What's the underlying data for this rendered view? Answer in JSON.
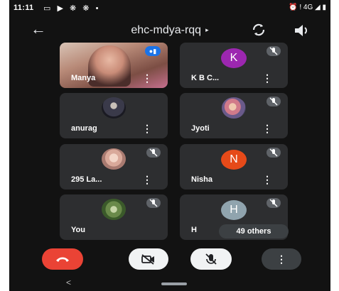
{
  "status": {
    "time": "11:11",
    "left_icons": [
      "cast-icon",
      "play-icon",
      "settings-icon",
      "settings-icon",
      "dot-icon"
    ],
    "right_text": "⏰ ! 4G ◢ ▮"
  },
  "topbar": {
    "meeting_code": "ehc-mdya-rqq",
    "code_arrow": "▸"
  },
  "tiles": [
    {
      "name": "Manya",
      "avatar": "video"
    },
    {
      "name": "K B C...",
      "avatar_letter": "K",
      "avatar_color": "#9c27b0"
    },
    {
      "name": "anurag",
      "avatar": "photo"
    },
    {
      "name": "Jyoti",
      "avatar": "photo"
    },
    {
      "name": "295 La...",
      "avatar": "photo"
    },
    {
      "name": "Nisha",
      "avatar_letter": "N",
      "avatar_color": "#e64a19"
    },
    {
      "name": "You",
      "avatar": "photo"
    },
    {
      "name": "H",
      "avatar_letter": "H",
      "avatar_color": "#90a4ae"
    }
  ],
  "others_label": "49 others",
  "menu_glyph": "⋮",
  "colors": {
    "background": "#121212",
    "tile": "#2d2e30",
    "end_call": "#ea4335",
    "speaking": "#1a73e8"
  },
  "controls": [
    "end-call-button",
    "camera-toggle-button",
    "mic-toggle-button",
    "more-options-button"
  ],
  "navbar": {
    "back_glyph": "<"
  }
}
